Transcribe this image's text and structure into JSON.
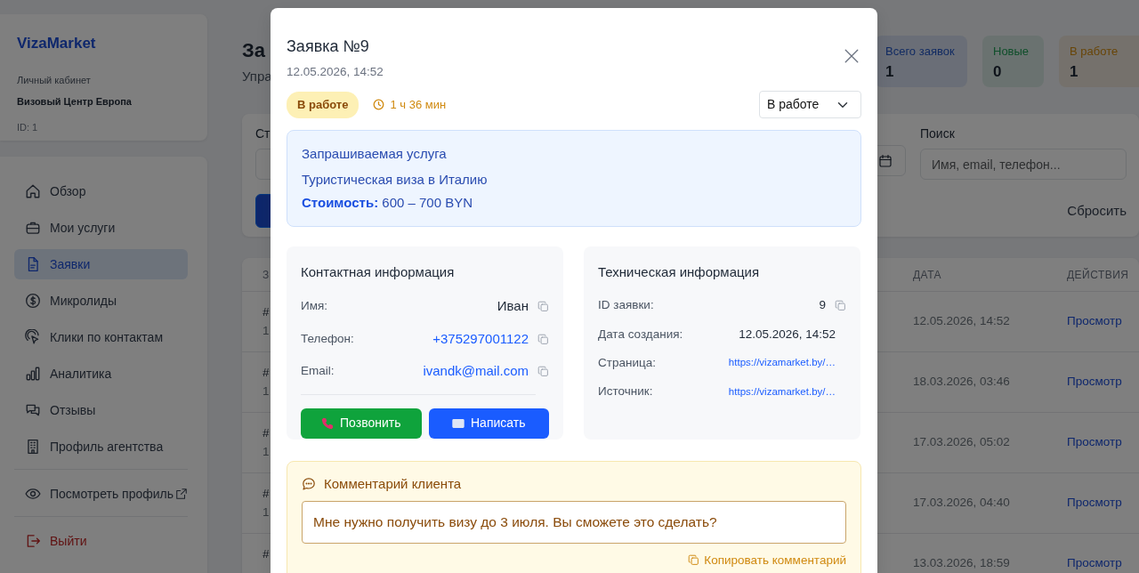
{
  "sidebar": {
    "brand": "VizaMarket",
    "account_label": "Личный кабинет",
    "agency": "Визовый Центр Европа",
    "account_id": "ID: 1",
    "nav": [
      {
        "label": "Обзор",
        "selected": false
      },
      {
        "label": "Мои услуги",
        "selected": false
      },
      {
        "label": "Заявки",
        "selected": true
      },
      {
        "label": "Микролиды",
        "selected": false
      },
      {
        "label": "Клики по контактам",
        "selected": false
      },
      {
        "label": "Аналитика",
        "selected": false
      },
      {
        "label": "Отзывы",
        "selected": false
      },
      {
        "label": "Профиль агентства",
        "selected": false
      }
    ],
    "view_profile": "Посмотреть профиль",
    "logout": "Выйти"
  },
  "page": {
    "title": "За",
    "subtitle": "Упра",
    "stats": [
      {
        "label": "Всего заявок",
        "value": "1"
      },
      {
        "label": "Новые",
        "value": "0"
      },
      {
        "label": "В работе",
        "value": "1"
      }
    ],
    "filters": {
      "status_label": "Ст",
      "search_label": "Поиск",
      "search_placeholder": "Имя, email, телефон...",
      "reset": "Сбросить"
    },
    "table": {
      "columns": [
        "З",
        "ДАТА",
        "ДЕЙСТВИЯ"
      ],
      "rows": [
        {
          "id": "#",
          "line_2": "1",
          "date": "12.05.2026, 14:52",
          "action": "Просмотр"
        },
        {
          "id": "#",
          "line_2": "1",
          "date": "18.03.2026, 03:46",
          "action": "Просмотр"
        },
        {
          "id": "#",
          "line_2": "1",
          "date": "17.03.2026, 05:02",
          "action": "Просмотр"
        },
        {
          "id": "#",
          "line_2": "1",
          "date": "17.03.2026, 04:40",
          "action": "Просмотр"
        },
        {
          "id": "#",
          "date": "13.03.2026, 18:59",
          "action": "Просмотр"
        }
      ]
    }
  },
  "modal": {
    "title": "Заявка №9",
    "created": "12.05.2026, 14:52",
    "status_badge": "В работе",
    "elapsed": "1 ч 36 мин",
    "status_select": "В работе",
    "service": {
      "heading": "Запрашиваемая услуга",
      "name": "Туристическая виза в Италию",
      "price": "**Стоимость:** 600 – 700 BYN"
    },
    "contact": {
      "title": "Контактная информация",
      "fields": [
        {
          "label": "Имя:",
          "value": "Иван",
          "kind": "text",
          "copyable": true
        },
        {
          "label": "Телефон:",
          "value": "+375297001122",
          "kind": "link",
          "copyable": true
        },
        {
          "label": "Email:",
          "value": "ivandk@mail.com",
          "kind": "link",
          "copyable": true
        }
      ],
      "call": "Позвонить",
      "write": "Написать"
    },
    "tech": {
      "title": "Техническая информация",
      "fields": [
        {
          "label": "ID заявки:",
          "value": "9",
          "kind": "text",
          "copyable": true
        },
        {
          "label": "Дата создания:",
          "value": "12.05.2026, 14:52",
          "kind": "text",
          "copyable": false
        },
        {
          "label": "Страница:",
          "value": "https://vizamarket.by/…",
          "kind": "url",
          "copyable": false
        },
        {
          "label": "Источник:",
          "value": "https://vizamarket.by/…",
          "kind": "url",
          "copyable": false
        }
      ]
    },
    "comment": {
      "title": "Комментарий клиента",
      "text": "Мне нужно получить визу до 3 июля. Вы сможете это сделать?",
      "copy": "Копировать комментарий"
    }
  }
}
